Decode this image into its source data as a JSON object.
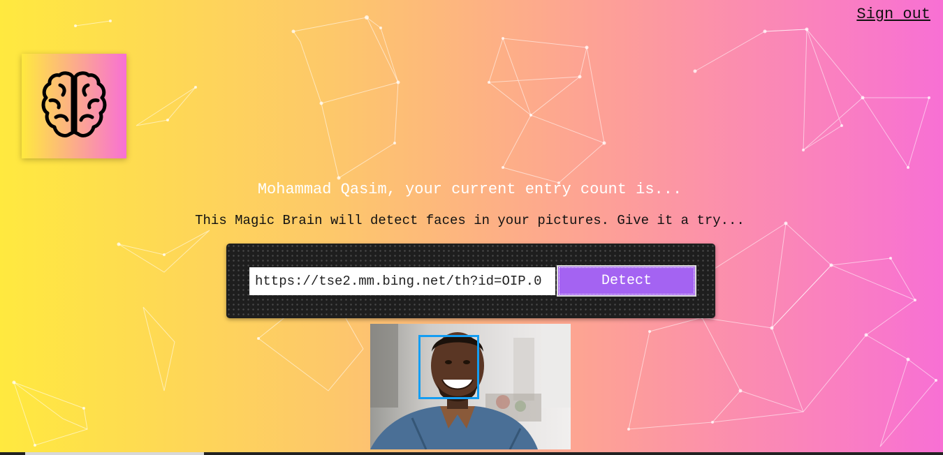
{
  "nav": {
    "signout_label": "Sign out"
  },
  "logo": {
    "icon": "brain-icon"
  },
  "rank": {
    "greeting": "Mohammad Qasim, your current entry count is..."
  },
  "tagline": "This Magic Brain will detect faces in your pictures. Give it a try...",
  "form": {
    "url_value": "https://tse2.mm.bing.net/th?id=OIP.0",
    "detect_label": "Detect"
  },
  "image": {
    "face_box_color": "#149df2"
  },
  "colors": {
    "gradient_start": "#ffe93f",
    "gradient_end": "#f870d4",
    "button": "#a463f2"
  }
}
